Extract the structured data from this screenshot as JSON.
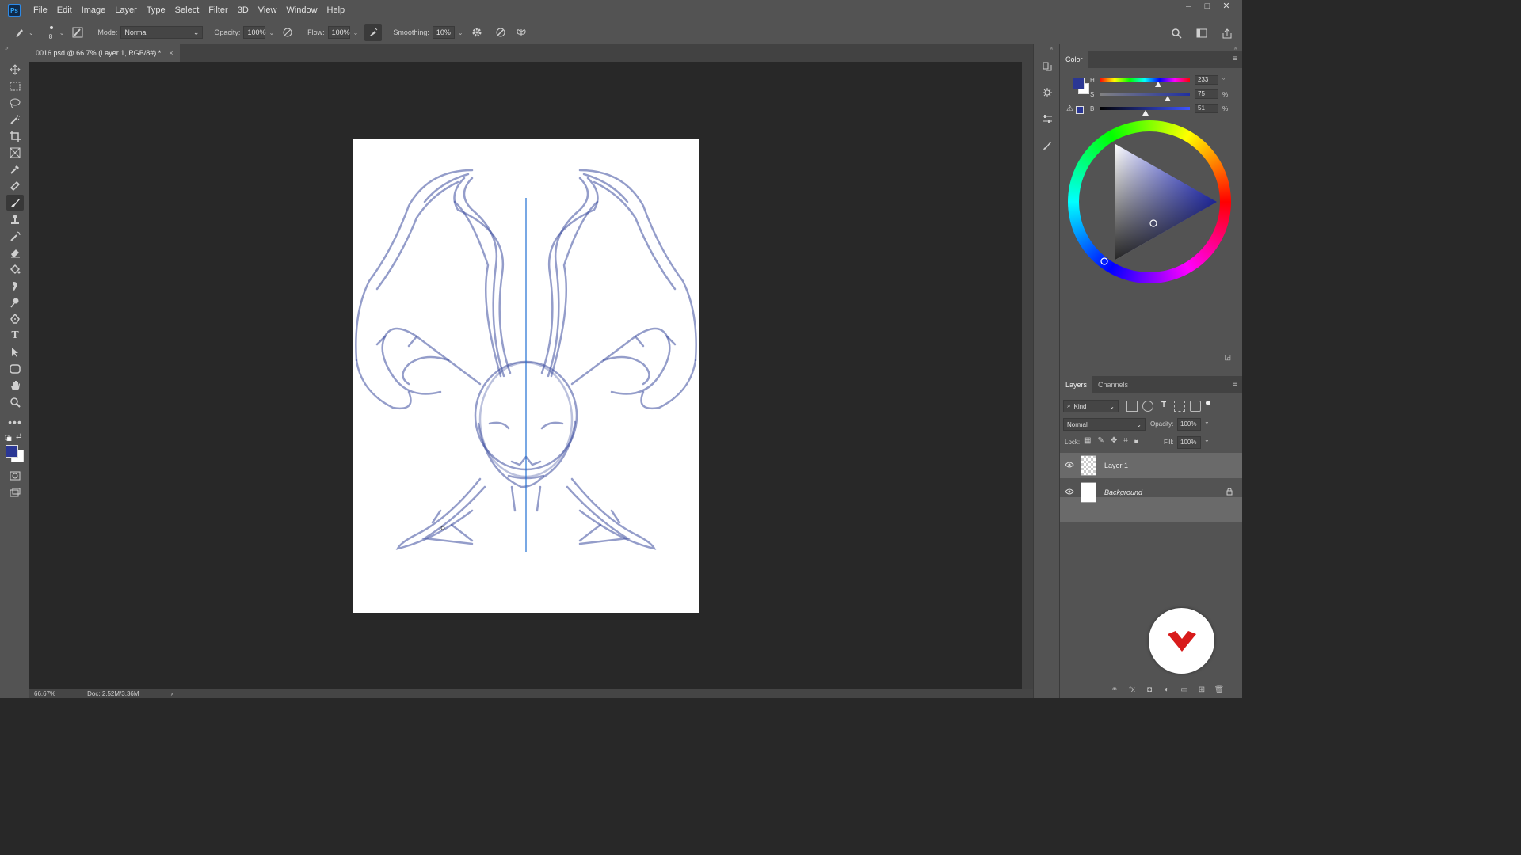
{
  "app": {
    "logo": "Ps"
  },
  "menu": [
    "File",
    "Edit",
    "Image",
    "Layer",
    "Type",
    "Select",
    "Filter",
    "3D",
    "View",
    "Window",
    "Help"
  ],
  "window_controls": {
    "minimize": "–",
    "maximize": "□",
    "close": "✕"
  },
  "options_bar": {
    "brush_size": "8",
    "mode_label": "Mode:",
    "mode_value": "Normal",
    "opacity_label": "Opacity:",
    "opacity_value": "100%",
    "flow_label": "Flow:",
    "flow_value": "100%",
    "smoothing_label": "Smoothing:",
    "smoothing_value": "10%"
  },
  "document_tab": {
    "title": "0016.psd @ 66.7% (Layer 1, RGB/8#) *",
    "close": "×"
  },
  "status_bar": {
    "zoom": "66.67%",
    "doc_size": "Doc: 2.52M/3.36M",
    "arrow": "›"
  },
  "color_panel": {
    "tab": "Color",
    "foreground_color": "#2b3794",
    "background_color": "#ffffff",
    "h_label": "H",
    "h_value": "233",
    "h_unit": "°",
    "h_level": 0.647,
    "s_label": "S",
    "s_value": "75",
    "s_unit": "%",
    "s_level": 0.75,
    "b_label": "B",
    "b_value": "51",
    "b_unit": "%",
    "b_level": 0.51
  },
  "layers_panel": {
    "tabs": [
      "Layers",
      "Channels"
    ],
    "filter_kind": "Kind",
    "blend_mode": "Normal",
    "opacity_label": "Opacity:",
    "opacity_value": "100%",
    "lock_label": "Lock:",
    "fill_label": "Fill:",
    "fill_value": "100%",
    "layers": [
      {
        "name": "Layer 1",
        "selected": true,
        "visible": true,
        "locked": false
      },
      {
        "name": "Background",
        "selected": false,
        "visible": true,
        "locked": true
      }
    ]
  },
  "accent_colors": {
    "stroke": "#3d4d9e",
    "guide": "#1f6fd1"
  }
}
